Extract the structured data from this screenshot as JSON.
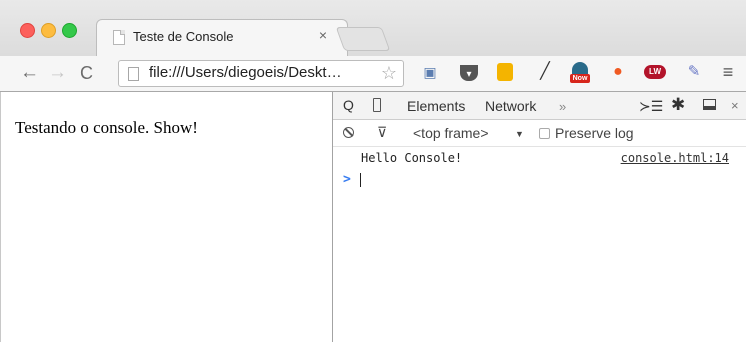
{
  "tab": {
    "title": "Teste de Console",
    "close": "×"
  },
  "toolbar": {
    "back": "←",
    "forward": "→",
    "reload": "C",
    "url": "file:///Users/diegoeis/Deskt…",
    "star": "☆",
    "extensions": [
      "pocket-icon",
      "notes-icon",
      "eyedropper-icon",
      "now-icon",
      "flame-icon",
      "lw-icon",
      "paint-icon"
    ],
    "ext_now_label": "Now",
    "ext_lw_label": "LW",
    "menu": "≡"
  },
  "page": {
    "text": "Testando o console. Show!"
  },
  "devtools": {
    "tabs": {
      "search": "Q",
      "elements": "Elements",
      "network": "Network",
      "more": "»",
      "drawer": "≻☰",
      "gear": "✱",
      "close": "×"
    },
    "console": {
      "filter": "⊽",
      "frame": "<top frame>",
      "frame_arrow": "▼",
      "preserve_log": "Preserve log",
      "log": {
        "message": "Hello Console!",
        "source": "console.html:14"
      },
      "prompt": ">"
    }
  },
  "colors": {
    "prompt_blue": "#367cf1",
    "close_red": "#fc605c",
    "minimize_yellow": "#fdbc40",
    "zoom_green": "#34c84a"
  }
}
